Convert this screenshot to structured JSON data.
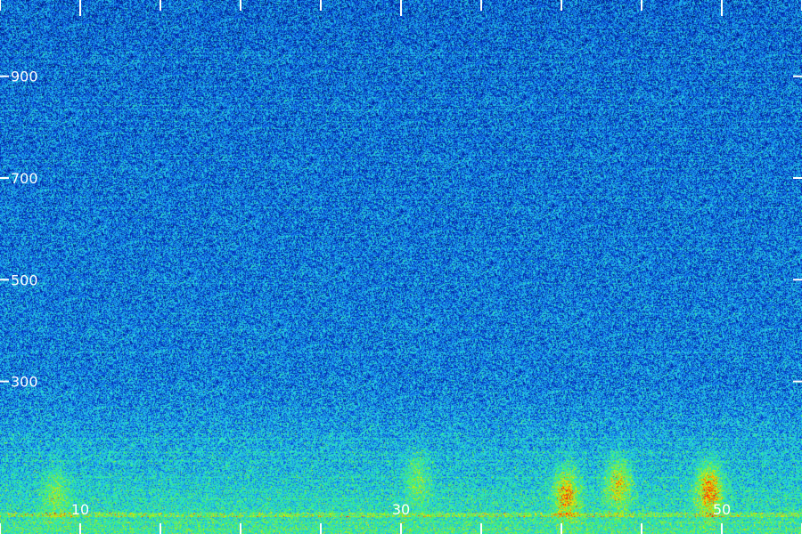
{
  "chart_data": {
    "type": "heatmap",
    "title": "",
    "xlabel": "",
    "ylabel": "",
    "xlim": [
      5,
      55
    ],
    "ylim": [
      0,
      1050
    ],
    "x_ticks_major": [
      10,
      30,
      50
    ],
    "x_ticks_minor": [
      5,
      15,
      20,
      25,
      35,
      40,
      45,
      55
    ],
    "y_ticks": [
      300,
      500,
      700,
      900
    ],
    "x_tick_labels": [
      "10",
      "30",
      "50"
    ],
    "y_tick_labels": [
      "300",
      "500",
      "700",
      "900"
    ],
    "grid": false,
    "legend": "none",
    "colormap": [
      "#000000",
      "#00208a",
      "#0a46d8",
      "#1aa0f0",
      "#2ee0d8",
      "#30f080",
      "#a0f020",
      "#ffe000",
      "#ff2000"
    ],
    "background_color": "#00104a",
    "tick_color": "#ffffff",
    "energy_band": {
      "y_range": [
        0,
        300
      ],
      "x_range": [
        5,
        55
      ],
      "description_level": "high"
    },
    "hotspots": [
      {
        "x": 40.3,
        "y": 80,
        "level": 0.85
      },
      {
        "x": 43.5,
        "y": 100,
        "level": 0.8
      },
      {
        "x": 49.2,
        "y": 90,
        "level": 0.9
      },
      {
        "x": 31.0,
        "y": 110,
        "level": 0.65
      },
      {
        "x": 8.5,
        "y": 80,
        "level": 0.65
      }
    ]
  }
}
